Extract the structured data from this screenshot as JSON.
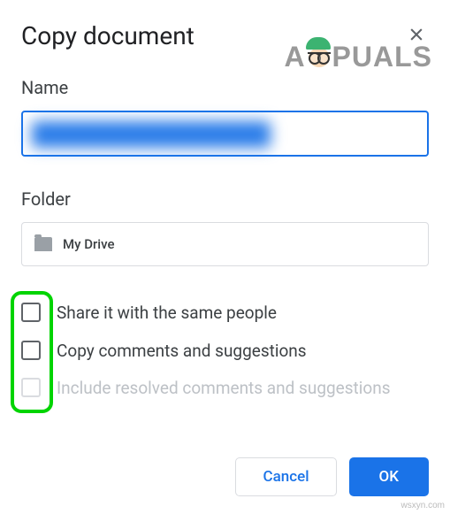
{
  "dialog": {
    "title": "Copy document",
    "name_label": "Name",
    "folder_label": "Folder",
    "folder_value": "My Drive",
    "checkboxes": [
      {
        "label": "Share it with the same people",
        "disabled": false
      },
      {
        "label": "Copy comments and suggestions",
        "disabled": false
      },
      {
        "label": "Include resolved comments and suggestions",
        "disabled": true
      }
    ],
    "buttons": {
      "cancel": "Cancel",
      "ok": "OK"
    }
  },
  "watermark": {
    "prefix": "A",
    "suffix": "PUALS"
  },
  "corner": "wsxyn.com"
}
